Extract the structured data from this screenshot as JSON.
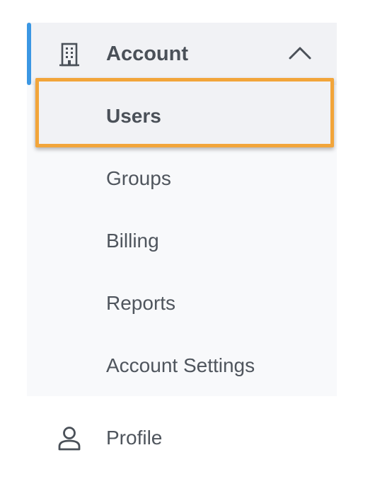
{
  "nav": {
    "account": {
      "label": "Account",
      "icon": "building-icon",
      "expanded": true,
      "accent_color": "#3b97e3"
    },
    "subitems": [
      {
        "label": "Users",
        "selected": true
      },
      {
        "label": "Groups",
        "selected": false
      },
      {
        "label": "Billing",
        "selected": false
      },
      {
        "label": "Reports",
        "selected": false
      },
      {
        "label": "Account Settings",
        "selected": false
      }
    ],
    "profile": {
      "label": "Profile",
      "icon": "user-icon"
    },
    "highlight_color": "#f2a53a"
  }
}
